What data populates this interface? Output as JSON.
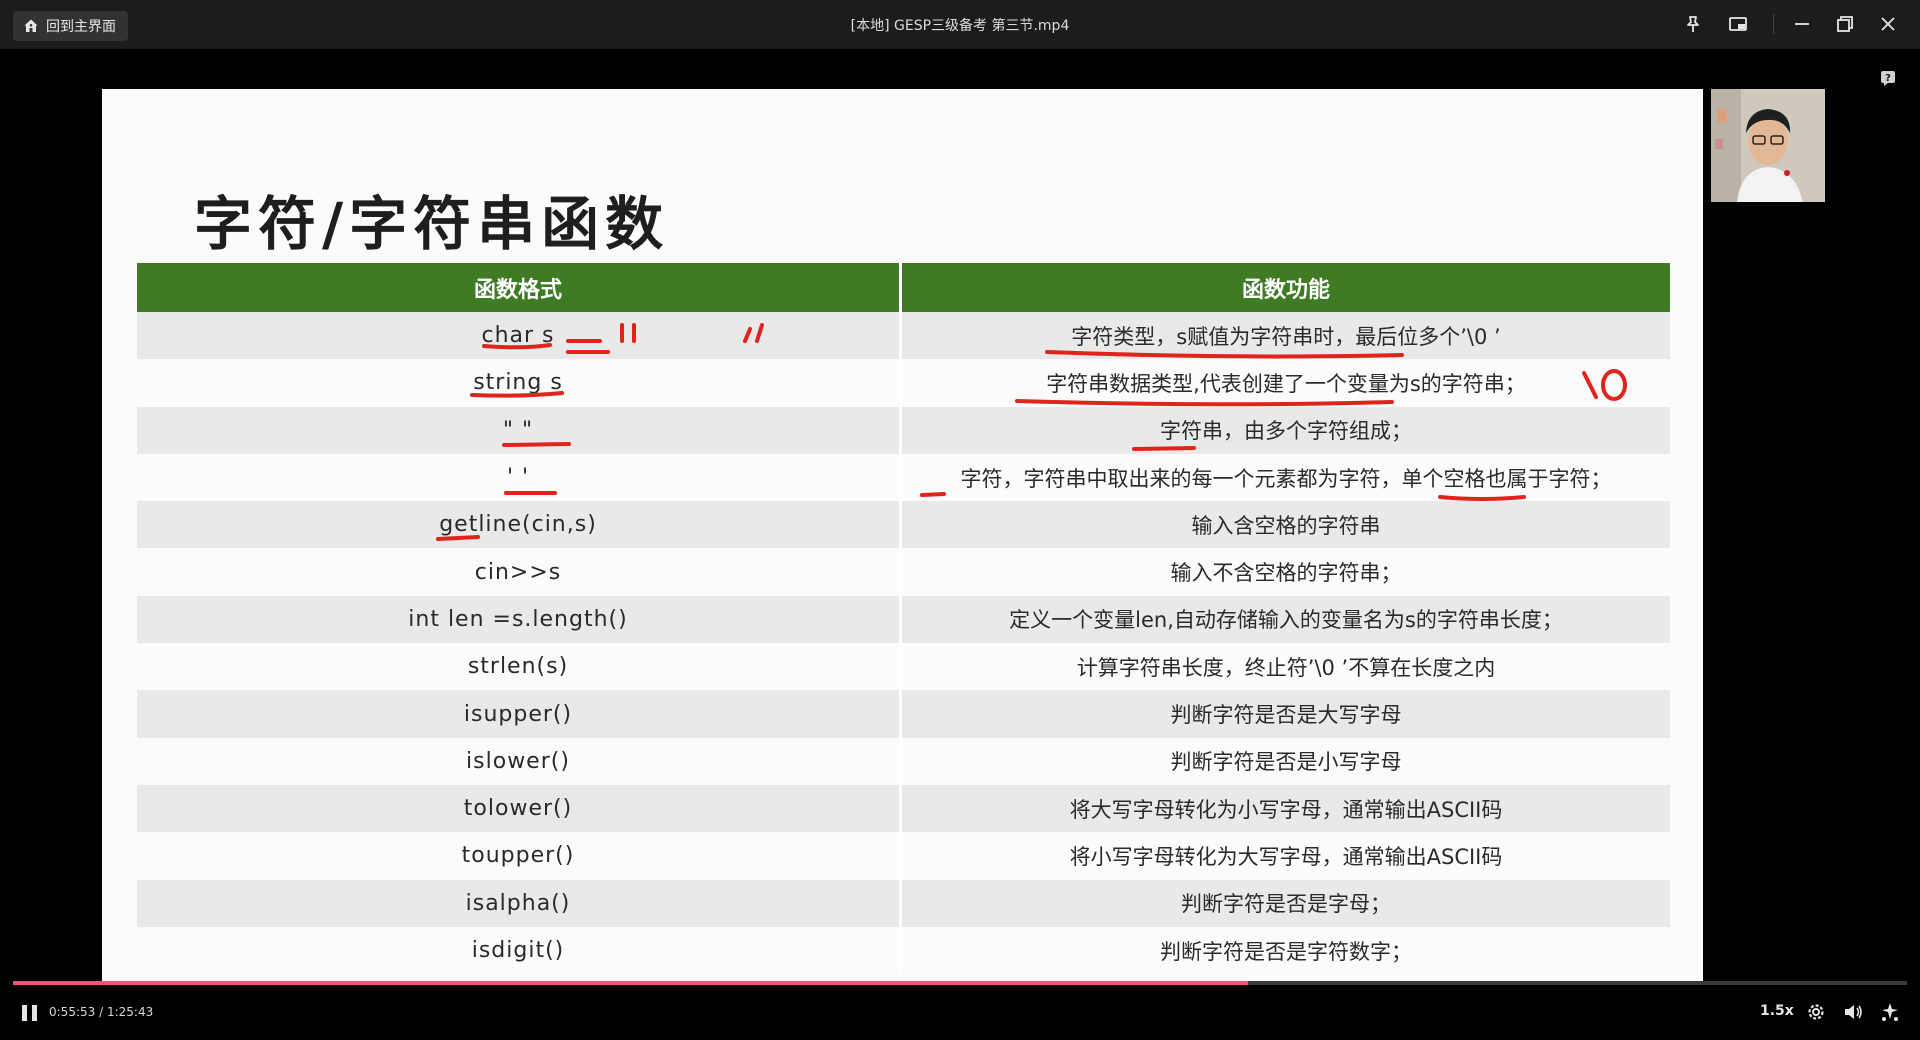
{
  "window": {
    "home_label": "回到主界面",
    "title": "[本地] GESP三级备考 第三节.mp4"
  },
  "slide": {
    "title": "字符/字符串函数",
    "headers": [
      "函数格式",
      "函数功能"
    ],
    "rows": [
      {
        "format": "char s",
        "function": "字符类型，s赋值为字符串时，最后位多个’\\0 ’"
      },
      {
        "format": "string s",
        "function": "字符串数据类型,代表创建了一个变量为s的字符串；"
      },
      {
        "format": "\" \"",
        "function": "字符串，由多个字符组成；"
      },
      {
        "format": "' '",
        "function": "字符，字符串中取出来的每一个元素都为字符，单个空格也属于字符；"
      },
      {
        "format": "getline(cin,s)",
        "function": "输入含空格的字符串"
      },
      {
        "format": "cin>>s",
        "function": "输入不含空格的字符串；"
      },
      {
        "format": "int len =s.length()",
        "function": "定义一个变量len,自动存储输入的变量名为s的字符串长度；"
      },
      {
        "format": "strlen(s)",
        "function": "计算字符串长度，终止符’\\0 ’不算在长度之内"
      },
      {
        "format": "isupper()",
        "function": "判断字符是否是大写字母"
      },
      {
        "format": "islower()",
        "function": "判断字符是否是小写字母"
      },
      {
        "format": "tolower()",
        "function": "将大写字母转化为小写字母，通常输出ASCII码"
      },
      {
        "format": "toupper()",
        "function": "将小写字母转化为大写字母，通常输出ASCII码"
      },
      {
        "format": "isalpha()",
        "function": "判断字符是否是字母；"
      },
      {
        "format": "isdigit()",
        "function": "判断字符是否是字符数字；"
      }
    ],
    "annotation_text": "\\0"
  },
  "player": {
    "current_time": "0:55:53",
    "separator": "/",
    "total_time": "1:25:43",
    "progress_fraction": 0.652,
    "speed": "1.5x",
    "accent_color": "#e8567a"
  },
  "icons": [
    "home-icon",
    "pin-icon",
    "picture-in-picture-icon",
    "minimize-icon",
    "restore-icon",
    "close-icon",
    "help-icon",
    "pause-icon",
    "settings-icon",
    "volume-icon",
    "ai-icon"
  ]
}
